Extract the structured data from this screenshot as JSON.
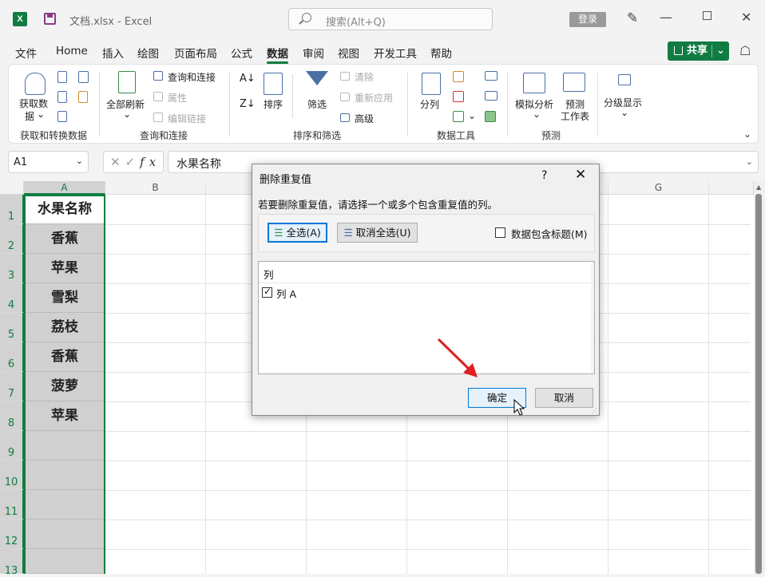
{
  "app": {
    "logo": "X",
    "title": "文档.xlsx  -  Excel",
    "search_placeholder": "搜索(Alt+Q)",
    "login": "登录"
  },
  "menu": [
    "文件",
    "Home",
    "插入",
    "绘图",
    "页面布局",
    "公式",
    "数据",
    "审阅",
    "视图",
    "开发工具",
    "帮助"
  ],
  "menu_active": "数据",
  "share_label": "共享",
  "ribbon": {
    "get_data_line1": "获取数",
    "get_data_line2": "据",
    "refresh_all": "全部刷新",
    "queries_connections": "查询和连接",
    "properties": "属性",
    "edit_links": "编辑链接",
    "sort": "排序",
    "filter": "筛选",
    "clear": "清除",
    "reapply": "重新应用",
    "advanced": "高级",
    "text_to_columns": "分列",
    "what_if": "模拟分析",
    "forecast_line1": "预测",
    "forecast_line2": "工作表",
    "outline": "分级显示",
    "groups": [
      "获取和转换数据",
      "查询和连接",
      "排序和筛选",
      "数据工具",
      "预测"
    ]
  },
  "formula_bar": {
    "name_box": "A1",
    "formula": "水果名称"
  },
  "columns": [
    "A",
    "B",
    "G"
  ],
  "rows": [
    "1",
    "2",
    "3",
    "4",
    "5",
    "6",
    "7",
    "8",
    "9",
    "10",
    "11",
    "12",
    "13"
  ],
  "column_a": [
    "水果名称",
    "香蕉",
    "苹果",
    "雪梨",
    "荔枝",
    "香蕉",
    "菠萝",
    "苹果"
  ],
  "dialog": {
    "title": "删除重复值",
    "help": "?",
    "instruction": "若要删除重复值，请选择一个或多个包含重复值的列。",
    "select_all": "全选(A)",
    "unselect_all": "取消全选(U)",
    "has_headers": "数据包含标题(M)",
    "has_headers_checked": false,
    "list_header": "列",
    "columns": [
      {
        "label": "列 A",
        "checked": true
      }
    ],
    "ok": "确定",
    "cancel": "取消"
  },
  "colors": {
    "excel_green": "#107c41",
    "selected_fill": "#d0d0d0",
    "arrow_red": "#e02020"
  }
}
